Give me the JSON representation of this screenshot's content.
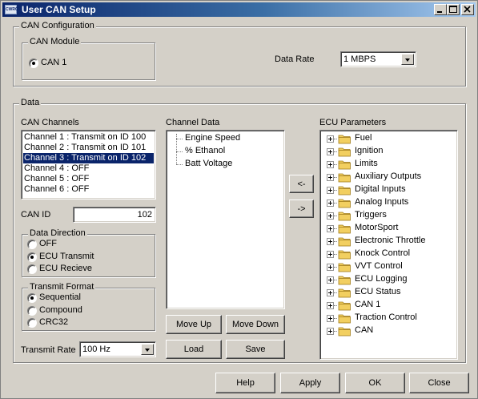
{
  "window": {
    "title": "User CAN Setup",
    "logo_text": "CWRC"
  },
  "can_config": {
    "group_label": "CAN Configuration",
    "module_group_label": "CAN Module",
    "module_option": "CAN 1",
    "data_rate_label": "Data Rate",
    "data_rate_value": "1 MBPS"
  },
  "data": {
    "group_label": "Data",
    "channels_label": "CAN Channels",
    "channels": [
      "Channel 1 : Transmit on ID 100",
      "Channel 2 : Transmit on ID 101",
      "Channel 3 : Transmit on ID 102",
      "Channel 4 : OFF",
      "Channel 5 : OFF",
      "Channel 6 : OFF"
    ],
    "selected_channel_index": 2,
    "can_id_label": "CAN ID",
    "can_id_value": "102",
    "direction": {
      "label": "Data Direction",
      "options": [
        "OFF",
        "ECU Transmit",
        "ECU Recieve"
      ],
      "selected": "ECU Transmit"
    },
    "format": {
      "label": "Transmit Format",
      "options": [
        "Sequential",
        "Compound",
        "CRC32"
      ],
      "selected": "Sequential"
    },
    "transmit_rate_label": "Transmit Rate",
    "transmit_rate_value": "100 Hz",
    "channel_data_label": "Channel Data",
    "channel_data_items": [
      "Engine Speed",
      "% Ethanol",
      "Batt Voltage"
    ],
    "move_up_label": "Move Up",
    "move_down_label": "Move Down",
    "load_label": "Load",
    "save_label": "Save",
    "remove_label": "<-",
    "add_label": "->",
    "ecu_params_label": "ECU Parameters",
    "ecu_params": [
      "Fuel",
      "Ignition",
      "Limits",
      "Auxiliary Outputs",
      "Digital Inputs",
      "Analog Inputs",
      "Triggers",
      "MotorSport",
      "Electronic Throttle",
      "Knock Control",
      "VVT Control",
      "ECU Logging",
      "ECU Status",
      "CAN 1",
      "Traction Control",
      "CAN"
    ]
  },
  "footer": {
    "help_label": "Help",
    "apply_label": "Apply",
    "ok_label": "OK",
    "close_label": "Close"
  },
  "colors": {
    "face": "#d4d0c8",
    "title_start": "#0a246a",
    "title_end": "#a6caf0",
    "selection": "#0a246a",
    "folder": "#f2cf60"
  }
}
